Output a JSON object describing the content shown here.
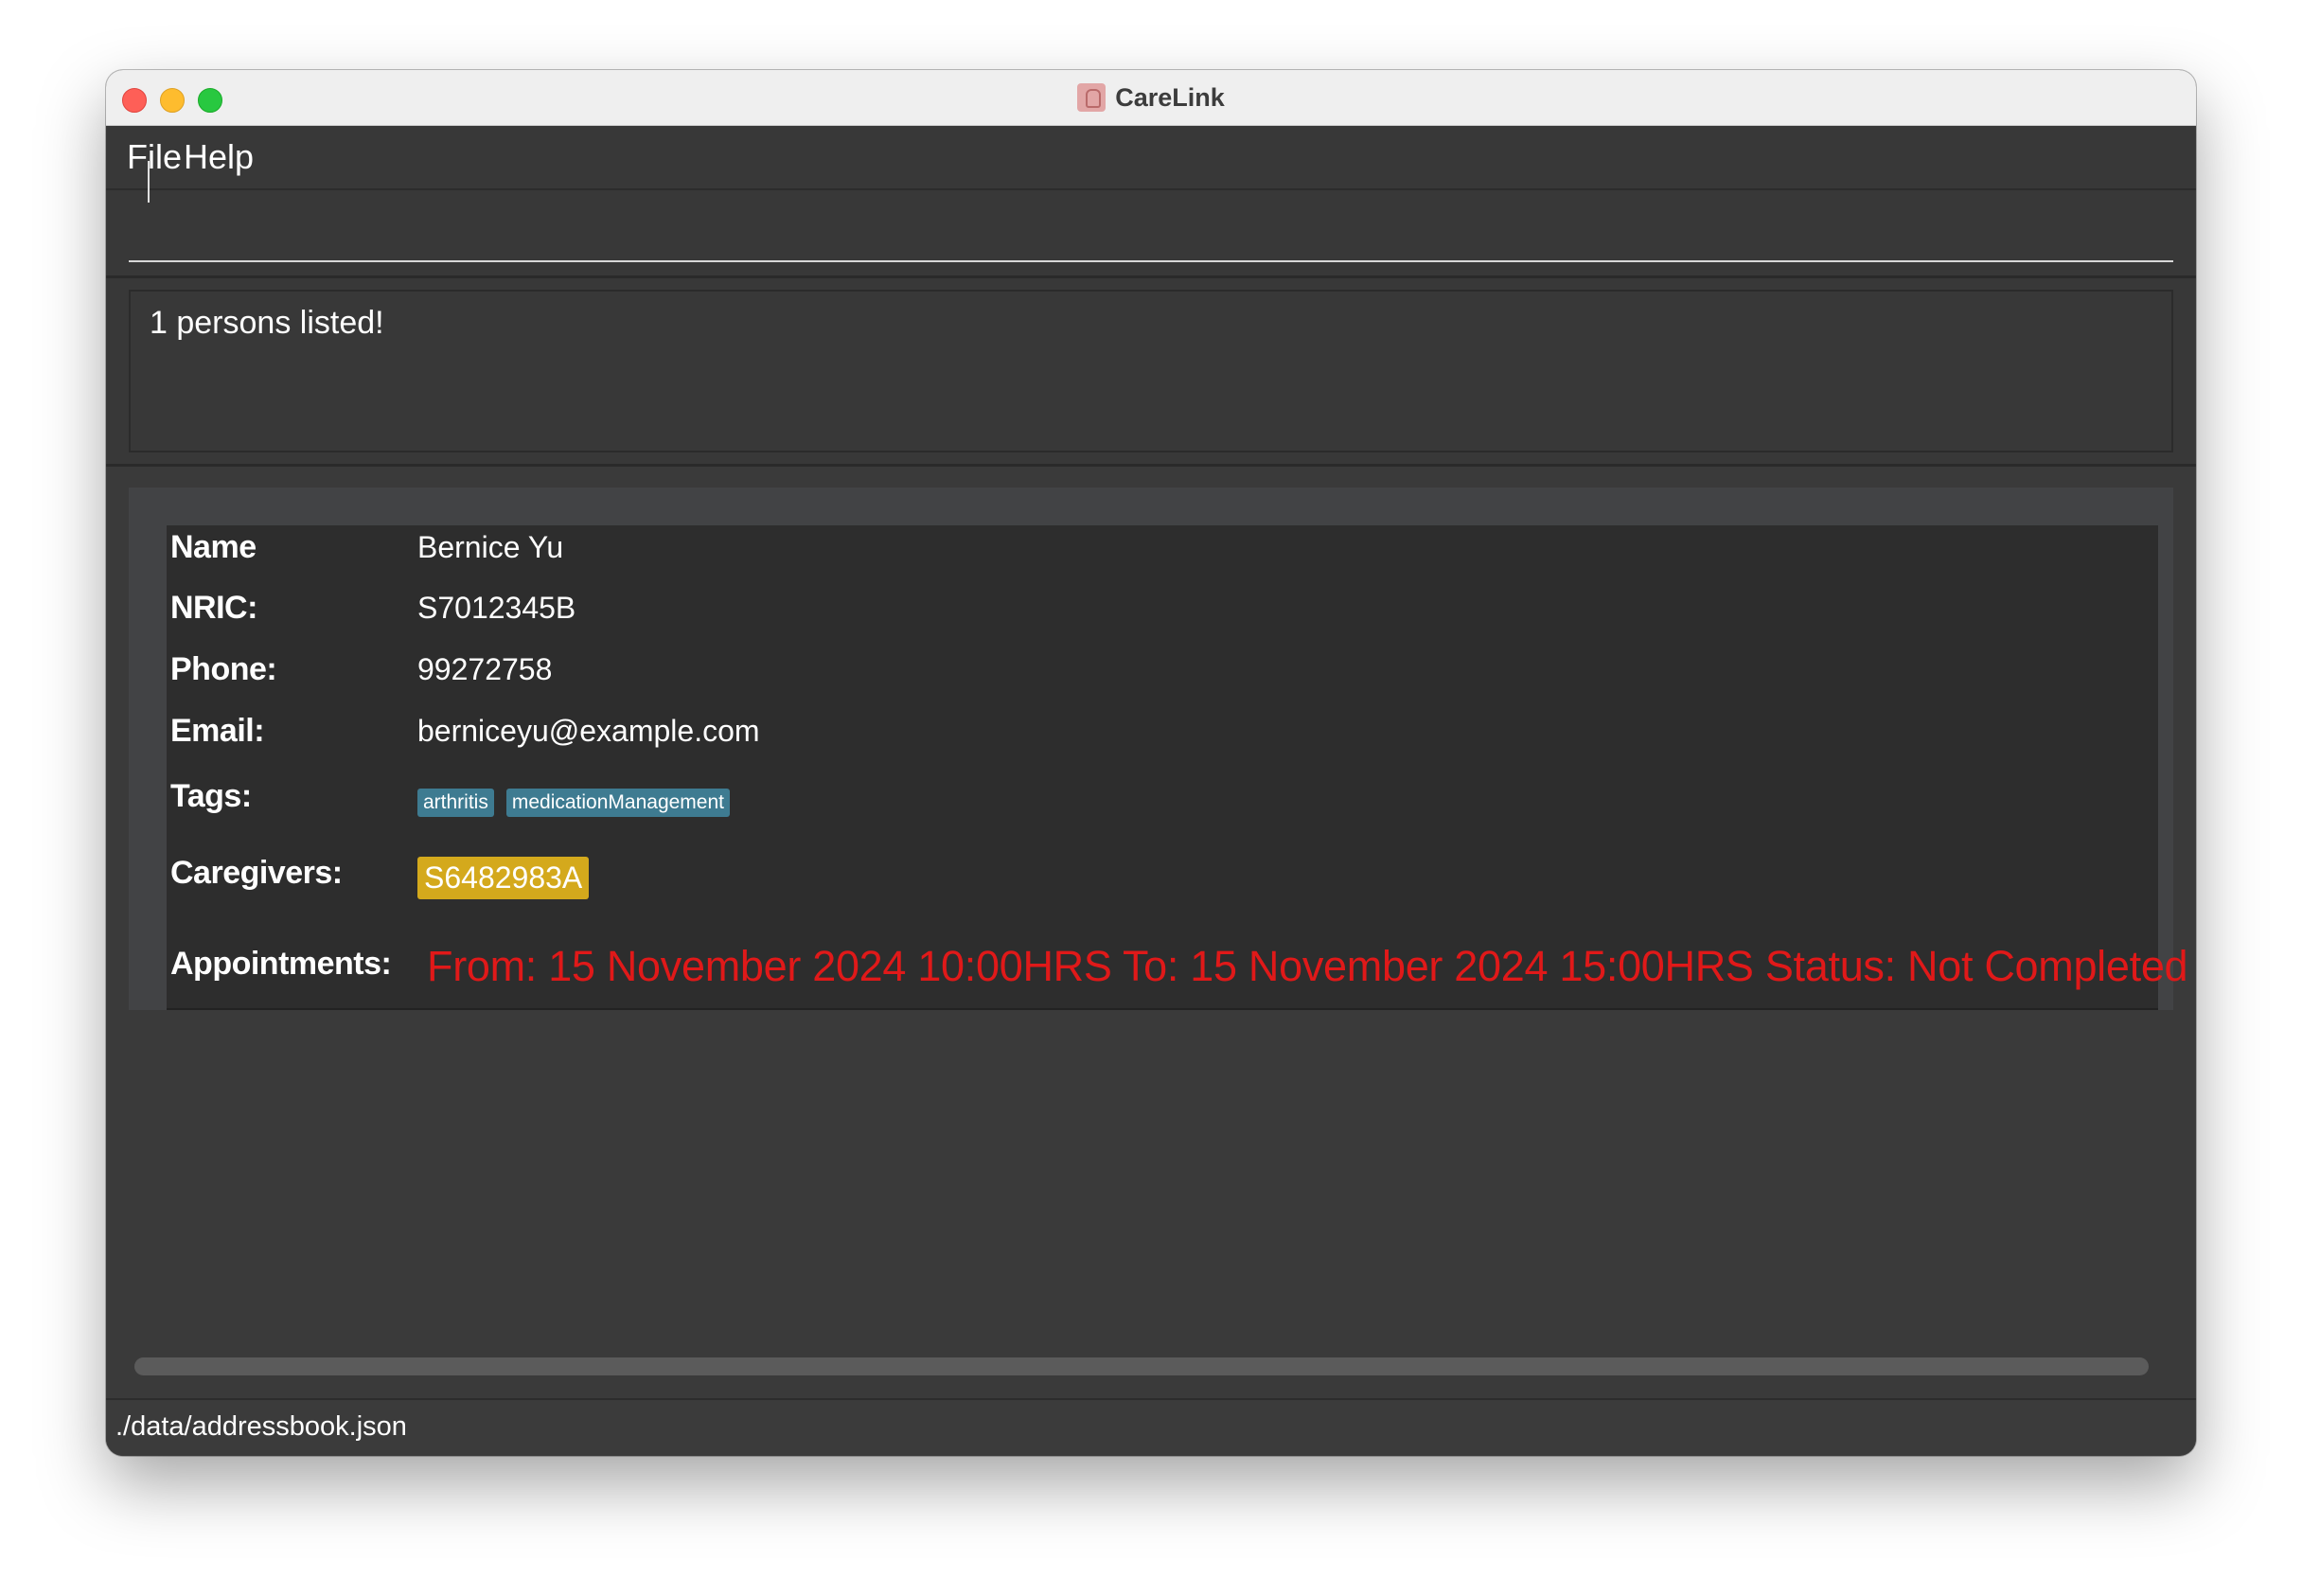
{
  "window": {
    "title": "CareLink",
    "icon": "app-logo-icon"
  },
  "menu": {
    "items": [
      {
        "label": "File"
      },
      {
        "label": "Help"
      }
    ]
  },
  "command": {
    "value": "",
    "placeholder": ""
  },
  "result": {
    "message": "1 persons listed!"
  },
  "person": {
    "labels": {
      "name": "Name",
      "nric": "NRIC:",
      "phone": "Phone:",
      "email": "Email:",
      "tags": "Tags:",
      "caregivers": "Caregivers:",
      "appointments": "Appointments:"
    },
    "name": "Bernice Yu",
    "nric": "S7012345B",
    "phone": "99272758",
    "email": "berniceyu@example.com",
    "tags": [
      "arthritis",
      "medicationManagement"
    ],
    "caregivers": [
      "S6482983A"
    ],
    "appointments": [
      "From: 15 November 2024 10:00HRS To: 15 November 2024 15:00HRS Status: Not Completed"
    ]
  },
  "status": {
    "file_path": "./data/addressbook.json"
  },
  "colors": {
    "tag_bg": "#3e7b91",
    "caregiver_bg": "#d4a91c",
    "appointment_text": "#e01919",
    "window_bg": "#3a3a3a"
  }
}
